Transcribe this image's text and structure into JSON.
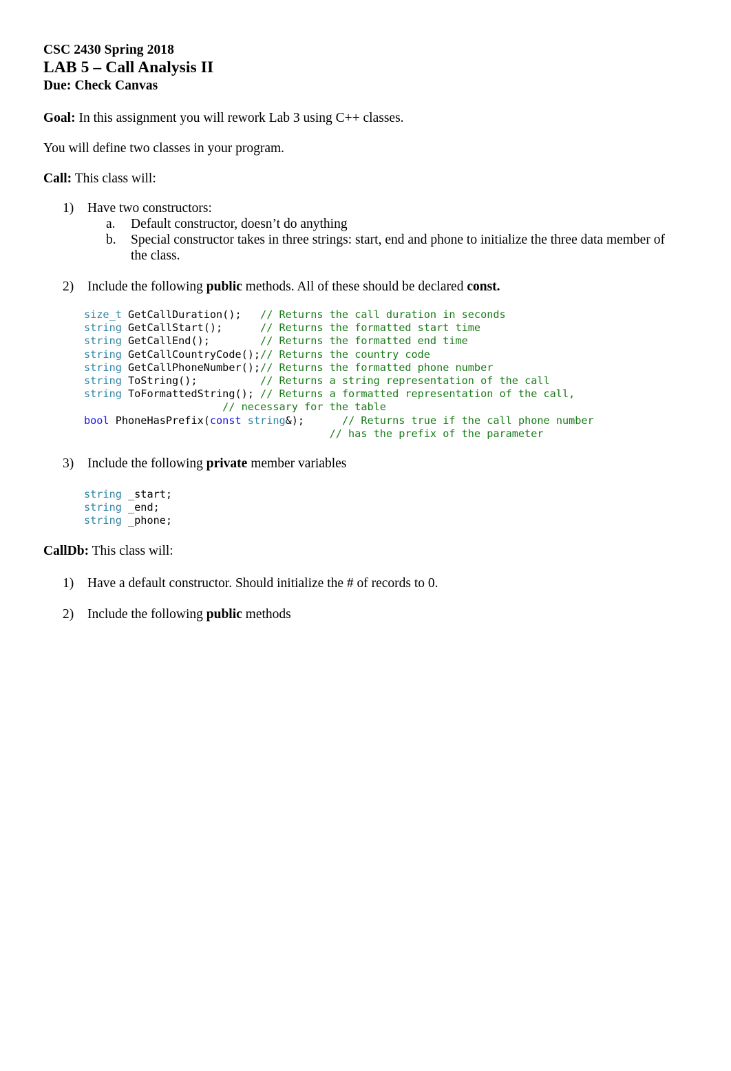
{
  "document": {
    "header": {
      "course": "CSC 2430 Spring 2018",
      "title": "LAB 5 – Call Analysis II",
      "due": "Due: Check Canvas"
    },
    "goal": {
      "label": "Goal:",
      "text": " In this assignment you will rework Lab 3 using C++ classes."
    },
    "intro": "You will define two classes in your program.",
    "call_section": {
      "label": "Call:",
      "text": "  This class will:",
      "items": [
        {
          "marker": "1)",
          "text": "Have two constructors:",
          "subitems": [
            {
              "marker": "a.",
              "text": "Default constructor, doesn’t do anything"
            },
            {
              "marker": "b.",
              "text": "Special constructor takes in three strings: start, end and phone to initialize the three data member of the class."
            }
          ]
        },
        {
          "marker": "2)",
          "pre": "Include the following ",
          "bold1": "public",
          "mid": " methods.  All of these should be declared ",
          "bold2": "const."
        },
        {
          "marker": "3)",
          "pre": "Include the following ",
          "bold1": "private",
          "mid": " member variables"
        }
      ]
    },
    "calldb_section": {
      "label": "CallDb:",
      "text": "  This class will:",
      "items": [
        {
          "marker": "1)",
          "text": "Have a default constructor.  Should initialize the # of records to 0."
        },
        {
          "marker": "2)",
          "pre": "Include the following ",
          "bold1": "public",
          "mid": " methods"
        }
      ]
    },
    "code_public_methods": {
      "lines": [
        {
          "type": "size_t",
          "sig": " GetCallDuration();   ",
          "comment": "// Returns the call duration in seconds"
        },
        {
          "type": "string",
          "sig": " GetCallStart();      ",
          "comment": "// Returns the formatted start time"
        },
        {
          "type": "string",
          "sig": " GetCallEnd();        ",
          "comment": "// Returns the formatted end time"
        },
        {
          "type": "string",
          "sig": " GetCallCountryCode();",
          "comment": "// Returns the country code"
        },
        {
          "type": "string",
          "sig": " GetCallPhoneNumber();",
          "comment": "// Returns the formatted phone number"
        },
        {
          "type": "string",
          "sig": " ToString();          ",
          "comment": "// Returns a string representation of the call"
        },
        {
          "type": "string",
          "sig": " ToFormattedString(); ",
          "comment": "// Returns a formatted representation of the call,"
        },
        {
          "type": "",
          "sig": "                      ",
          "comment": "// necessary for the table"
        }
      ],
      "last": {
        "kw1": "bool",
        "mid1": " PhoneHasPrefix(",
        "kw2": "const",
        "space": " ",
        "ty": "string",
        "mid2": "&);      ",
        "comment": "// Returns true if the call phone number"
      },
      "last_cont": {
        "pad": "                                       ",
        "comment": "// has the prefix of the parameter"
      }
    },
    "code_private_members": {
      "lines": [
        {
          "type": "string",
          "rest": " _start;"
        },
        {
          "type": "string",
          "rest": " _end;"
        },
        {
          "type": "string",
          "rest": " _phone;"
        }
      ]
    },
    "colors": {
      "type_teal": "#2f84a3",
      "keyword_blue": "#1515ee",
      "comment_green": "#177a17",
      "text_black": "#000000",
      "page_background": "#ffffff"
    }
  }
}
